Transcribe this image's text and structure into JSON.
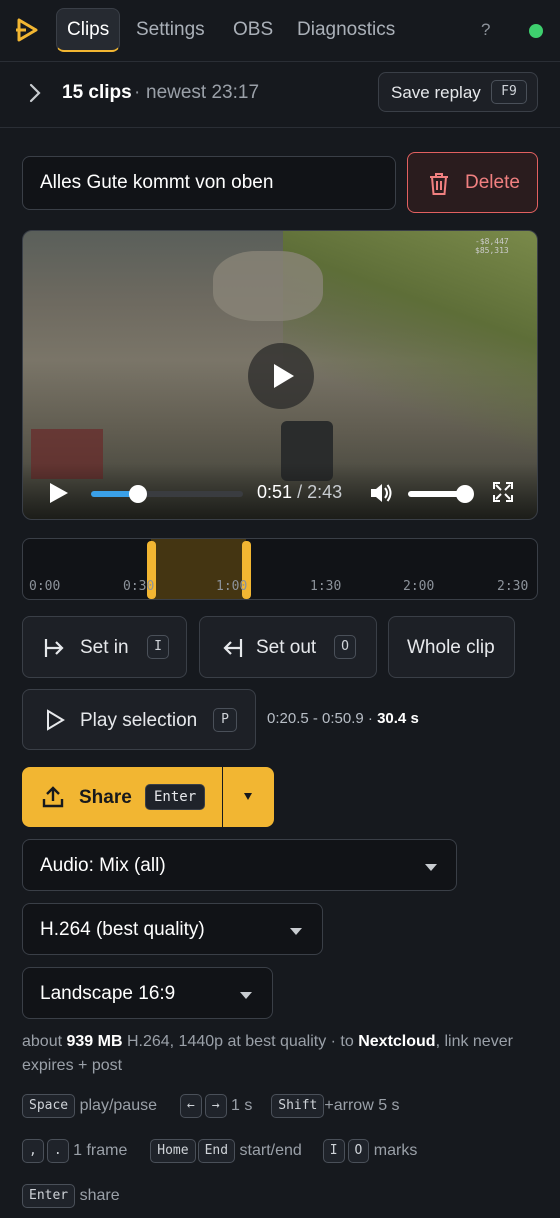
{
  "nav": {
    "tabs": [
      {
        "label": "Clips",
        "active": true
      },
      {
        "label": "Settings",
        "active": false
      },
      {
        "label": "OBS",
        "active": false
      },
      {
        "label": "Diagnostics",
        "active": false
      }
    ],
    "help": "?",
    "status_color": "#3ecf6e"
  },
  "clips": {
    "count": "15 clips",
    "separator": "·",
    "newest": "newest 23:17",
    "save_replay": "Save replay",
    "save_replay_key": "F9"
  },
  "editor": {
    "title_value": "Alles Gute kommt von oben",
    "delete_label": "Delete"
  },
  "player": {
    "current": "0:51",
    "duration": "/ 2:43",
    "progress": 0.31,
    "volume": 0.95,
    "hud_text": "-$8,447  $85,313"
  },
  "timeline": {
    "ticks": [
      "0:00",
      "0:30",
      "1:00",
      "1:30",
      "2:00",
      "2:30"
    ],
    "total_seconds": 163,
    "in_seconds": 20.5,
    "out_seconds": 50.9
  },
  "actions": {
    "set_in": "Set in",
    "set_in_key": "I",
    "set_out": "Set out",
    "set_out_key": "O",
    "whole_clip": "Whole clip",
    "play_selection": "Play selection",
    "play_selection_key": "P",
    "selection_range": "0:20.5 - 0:50.9 · ",
    "selection_length": "30.4 s"
  },
  "share": {
    "label": "Share",
    "key": "Enter",
    "accent": "#f2b632"
  },
  "options": {
    "audio": "Audio: Mix (all)",
    "codec": "H.264 (best quality)",
    "layout": "Landscape 16:9"
  },
  "summary": {
    "prefix": "about ",
    "size": "939 MB",
    "middle": " H.264, 1440p at best quality · to ",
    "target": "Nextcloud",
    "suffix": ", link never expires + post"
  },
  "hints": {
    "space": "Space",
    "space_text": "play/pause",
    "left": "←",
    "right": "→",
    "arrow_text": "1 s",
    "shift": "Shift",
    "shift_text": "+arrow 5 s",
    "comma": ",",
    "period": ".",
    "frame_text": "1 frame",
    "home": "Home",
    "end": "End",
    "startend_text": "start/end",
    "i": "I",
    "o": "O",
    "marks_text": "marks",
    "enter": "Enter",
    "share_text": "share"
  }
}
